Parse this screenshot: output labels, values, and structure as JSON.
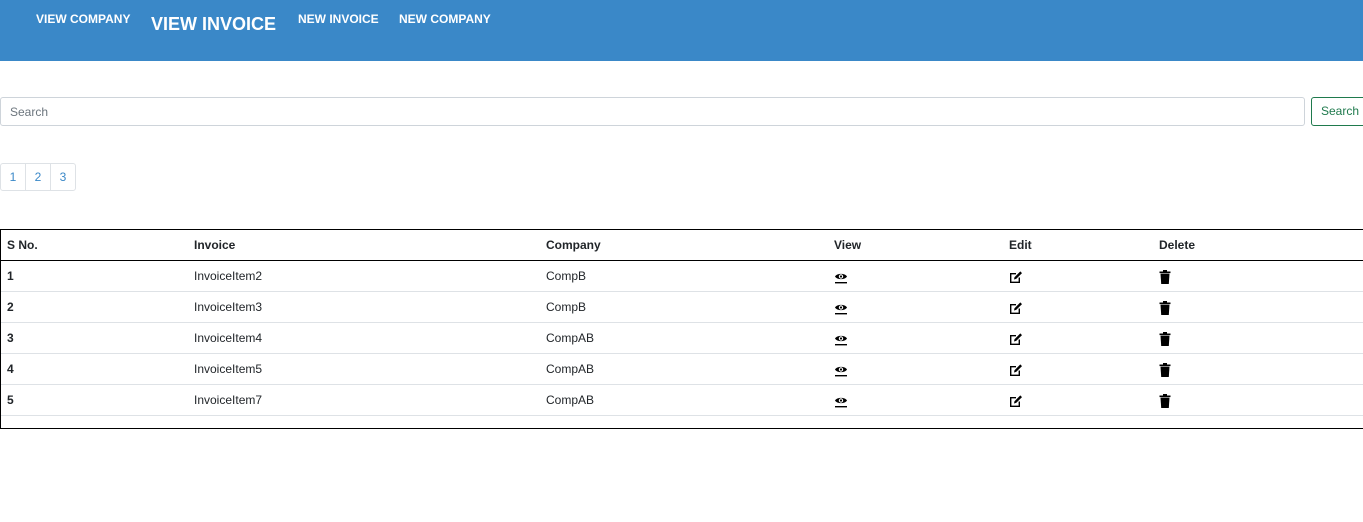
{
  "nav": {
    "view_company": "VIEW COMPANY",
    "view_invoice": "VIEW INVOICE",
    "new_invoice": "NEW INVOICE",
    "new_company": "NEW COMPANY"
  },
  "search": {
    "placeholder": "Search",
    "button_label": "Search"
  },
  "pagination": [
    "1",
    "2",
    "3"
  ],
  "table": {
    "headers": {
      "sno": "S No.",
      "invoice": "Invoice",
      "company": "Company",
      "view": "View",
      "edit": "Edit",
      "delete": "Delete"
    },
    "rows": [
      {
        "sno": "1",
        "invoice": "InvoiceItem2",
        "company": "CompB"
      },
      {
        "sno": "2",
        "invoice": "InvoiceItem3",
        "company": "CompB"
      },
      {
        "sno": "3",
        "invoice": "InvoiceItem4",
        "company": "CompAB"
      },
      {
        "sno": "4",
        "invoice": "InvoiceItem5",
        "company": "CompAB"
      },
      {
        "sno": "5",
        "invoice": "InvoiceItem7",
        "company": "CompAB"
      }
    ]
  },
  "icons": {
    "view": "eye-icon",
    "edit": "edit-icon",
    "delete": "trash-icon"
  },
  "colors": {
    "navbar": "#3a88c8",
    "link": "#3a88c8",
    "search_button": "#1f7a4d"
  }
}
